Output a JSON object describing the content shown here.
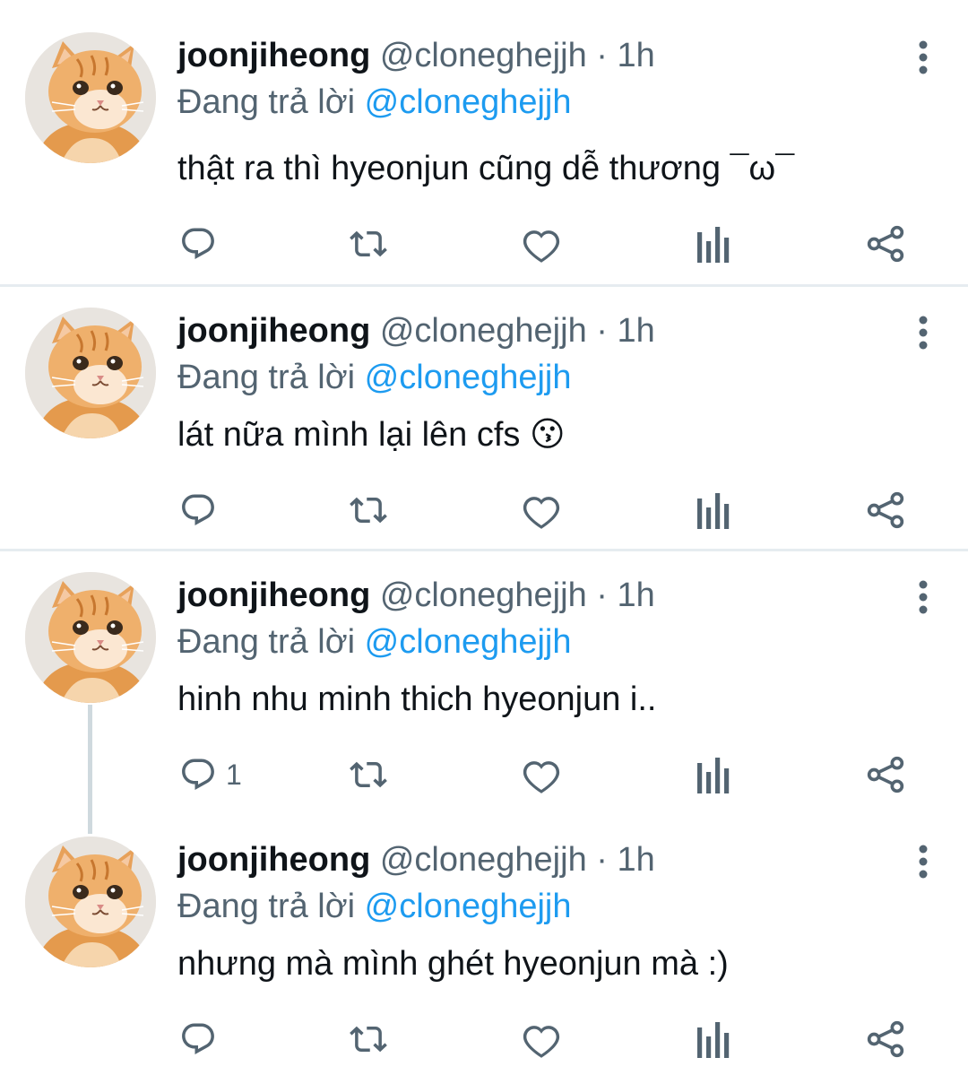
{
  "tweets": [
    {
      "display_name": "joonjiheong",
      "handle": "@cloneghejjh",
      "time": "1h",
      "reply_prefix": "Đang trả lời",
      "reply_to": "@cloneghejjh",
      "text": "thật ra thì hyeonjun cũng dễ thương ¯ω¯",
      "reply_count": ""
    },
    {
      "display_name": "joonjiheong",
      "handle": "@cloneghejjh",
      "time": "1h",
      "reply_prefix": "Đang trả lời",
      "reply_to": "@cloneghejjh",
      "text": "lát nữa mình lại lên cfs 😗",
      "reply_count": ""
    },
    {
      "display_name": "joonjiheong",
      "handle": "@cloneghejjh",
      "time": "1h",
      "reply_prefix": "Đang trả lời",
      "reply_to": "@cloneghejjh",
      "text": "hinh nhu minh thich hyeonjun i..",
      "reply_count": "1"
    },
    {
      "display_name": "joonjiheong",
      "handle": "@cloneghejjh",
      "time": "1h",
      "reply_prefix": "Đang trả lời",
      "reply_to": "@cloneghejjh",
      "text": "nhưng mà mình ghét hyeonjun mà :)",
      "reply_count": ""
    }
  ],
  "separator": " · ",
  "icons": {
    "reply": "reply-icon",
    "retweet": "retweet-icon",
    "like": "heart-icon",
    "views": "analytics-icon",
    "share": "share-icon",
    "more": "more-vertical-icon",
    "avatar": "cat-avatar"
  },
  "colors": {
    "link": "#1d9bf0",
    "secondary_text": "#536471",
    "primary_text": "#0f1419",
    "divider": "#e6ecf0"
  }
}
